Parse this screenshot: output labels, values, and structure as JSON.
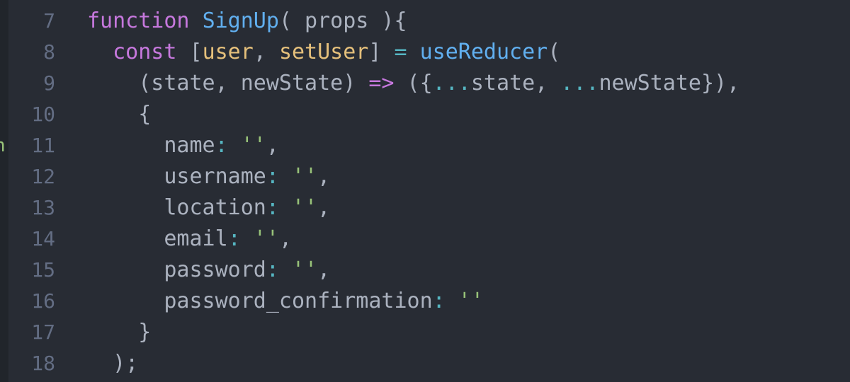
{
  "editor": {
    "edge_mark": "n",
    "lines": [
      {
        "number": "7",
        "tokens": [
          {
            "text": "function",
            "kind": "kw"
          },
          {
            "text": " ",
            "kind": "plain"
          },
          {
            "text": "SignUp",
            "kind": "fn"
          },
          {
            "text": "( props ){",
            "kind": "plain"
          }
        ]
      },
      {
        "number": "8",
        "tokens": [
          {
            "text": "  ",
            "kind": "plain"
          },
          {
            "text": "const",
            "kind": "kw"
          },
          {
            "text": " [",
            "kind": "plain"
          },
          {
            "text": "user",
            "kind": "var"
          },
          {
            "text": ", ",
            "kind": "plain"
          },
          {
            "text": "setUser",
            "kind": "var"
          },
          {
            "text": "] ",
            "kind": "plain"
          },
          {
            "text": "=",
            "kind": "op"
          },
          {
            "text": " ",
            "kind": "plain"
          },
          {
            "text": "useReducer",
            "kind": "fn"
          },
          {
            "text": "(",
            "kind": "plain"
          }
        ]
      },
      {
        "number": "9",
        "tokens": [
          {
            "text": "    (state, newState) ",
            "kind": "plain"
          },
          {
            "text": "=>",
            "kind": "kw"
          },
          {
            "text": " ({",
            "kind": "plain"
          },
          {
            "text": "...",
            "kind": "op"
          },
          {
            "text": "state, ",
            "kind": "plain"
          },
          {
            "text": "...",
            "kind": "op"
          },
          {
            "text": "newState}),",
            "kind": "plain"
          }
        ]
      },
      {
        "number": "10",
        "tokens": [
          {
            "text": "    {",
            "kind": "plain"
          }
        ]
      },
      {
        "number": "11",
        "tokens": [
          {
            "text": "      name",
            "kind": "plain"
          },
          {
            "text": ":",
            "kind": "op"
          },
          {
            "text": " ",
            "kind": "plain"
          },
          {
            "text": "''",
            "kind": "str"
          },
          {
            "text": ",",
            "kind": "plain"
          }
        ]
      },
      {
        "number": "12",
        "tokens": [
          {
            "text": "      username",
            "kind": "plain"
          },
          {
            "text": ":",
            "kind": "op"
          },
          {
            "text": " ",
            "kind": "plain"
          },
          {
            "text": "''",
            "kind": "str"
          },
          {
            "text": ",",
            "kind": "plain"
          }
        ]
      },
      {
        "number": "13",
        "tokens": [
          {
            "text": "      location",
            "kind": "plain"
          },
          {
            "text": ":",
            "kind": "op"
          },
          {
            "text": " ",
            "kind": "plain"
          },
          {
            "text": "''",
            "kind": "str"
          },
          {
            "text": ",",
            "kind": "plain"
          }
        ]
      },
      {
        "number": "14",
        "tokens": [
          {
            "text": "      email",
            "kind": "plain"
          },
          {
            "text": ":",
            "kind": "op"
          },
          {
            "text": " ",
            "kind": "plain"
          },
          {
            "text": "''",
            "kind": "str"
          },
          {
            "text": ",",
            "kind": "plain"
          }
        ]
      },
      {
        "number": "15",
        "tokens": [
          {
            "text": "      password",
            "kind": "plain"
          },
          {
            "text": ":",
            "kind": "op"
          },
          {
            "text": " ",
            "kind": "plain"
          },
          {
            "text": "''",
            "kind": "str"
          },
          {
            "text": ",",
            "kind": "plain"
          }
        ]
      },
      {
        "number": "16",
        "tokens": [
          {
            "text": "      password_confirmation",
            "kind": "plain"
          },
          {
            "text": ":",
            "kind": "op"
          },
          {
            "text": " ",
            "kind": "plain"
          },
          {
            "text": "''",
            "kind": "str"
          }
        ]
      },
      {
        "number": "17",
        "tokens": [
          {
            "text": "    }",
            "kind": "plain"
          }
        ]
      },
      {
        "number": "18",
        "tokens": [
          {
            "text": "  );",
            "kind": "plain"
          }
        ]
      }
    ]
  },
  "colors": {
    "background": "#282c34",
    "line_number": "#636d83",
    "keyword": "#c678dd",
    "function": "#61afef",
    "variable": "#e5c07b",
    "operator": "#56b6c2",
    "string": "#98c379",
    "plain": "#abb2bf"
  }
}
